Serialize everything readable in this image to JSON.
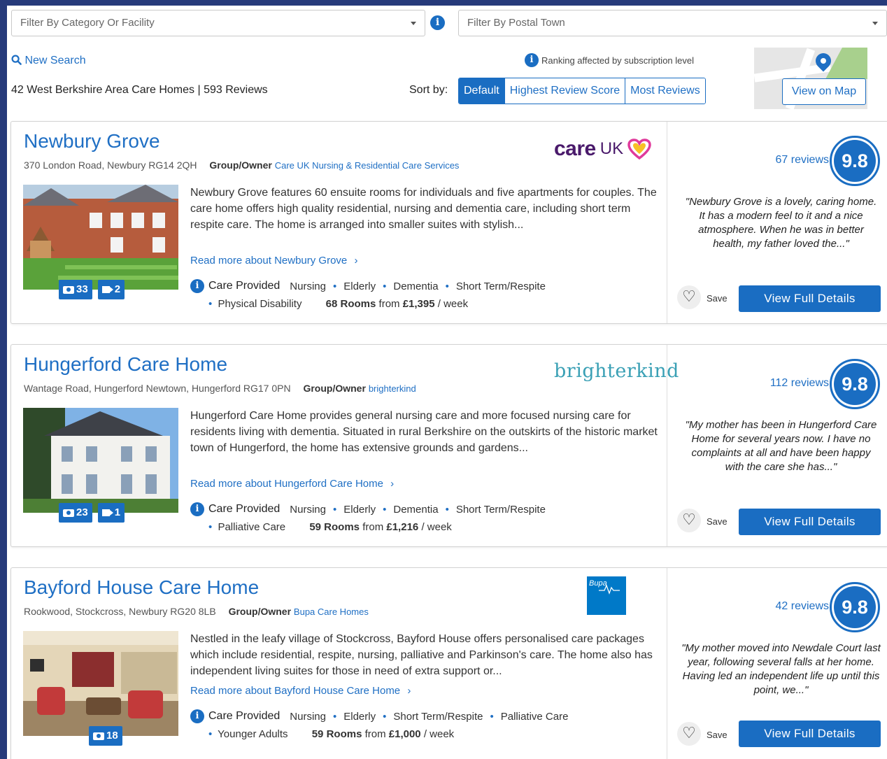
{
  "filters": {
    "category_placeholder": "Filter By Category Or Facility",
    "postal_placeholder": "Filter By Postal Town"
  },
  "toolbar": {
    "new_search": "New Search",
    "ranking_note": "Ranking affected by subscription level",
    "summary": "42 West Berkshire Area Care Homes | 593 Reviews",
    "sort_label": "Sort by:",
    "sort_options": [
      "Default",
      "Highest Review Score",
      "Most Reviews"
    ],
    "sort_selected": "Default",
    "view_on_map": "View on Map"
  },
  "labels": {
    "care_provided": "Care Provided",
    "save": "Save",
    "view_full_details": "View Full Details"
  },
  "colors": {
    "accent": "#1a6dc2",
    "background": "#263a7a",
    "link": "#1f6fc4"
  },
  "homes": [
    {
      "name": "Newbury Grove",
      "address": "370 London Road, Newbury RG14 2QH",
      "owner_label": "Group/Owner",
      "owner": "Care UK Nursing & Residential Care Services",
      "logo": "care UK",
      "description": "Newbury Grove features 60 ensuite rooms for individuals and five apartments for couples. The care home offers high quality residential, nursing and dementia care, including short term respite care. The home is arranged into smaller suites with stylish...",
      "read_more": "Read more about Newbury Grove",
      "photos": "33",
      "videos": "2",
      "care": [
        "Nursing",
        "Elderly",
        "Dementia",
        "Short Term/Respite"
      ],
      "care_extra": "Physical Disability",
      "rooms": "68 Rooms",
      "from_label": "from",
      "price": "£1,395",
      "per": "/ week",
      "reviews": "67 reviews",
      "score": "9.8",
      "quote": "\"Newbury Grove is a lovely, caring home. It has a modern feel to it and a nice atmosphere. When he was in better health, my father loved the...\""
    },
    {
      "name": "Hungerford Care Home",
      "address": "Wantage Road, Hungerford Newtown, Hungerford RG17 0PN",
      "owner_label": "Group/Owner",
      "owner": "brighterkind",
      "logo": "brighterkind",
      "description": "Hungerford Care Home provides general nursing care and more focused nursing care for residents living with dementia. Situated in rural Berkshire on the outskirts of the historic market town of Hungerford, the home has extensive grounds and gardens...",
      "read_more": "Read more about Hungerford Care Home",
      "photos": "23",
      "videos": "1",
      "care": [
        "Nursing",
        "Elderly",
        "Dementia",
        "Short Term/Respite"
      ],
      "care_extra": "Palliative Care",
      "rooms": "59 Rooms",
      "from_label": "from",
      "price": "£1,216",
      "per": "/ week",
      "reviews": "112 reviews",
      "score": "9.8",
      "quote": "\"My mother has been in Hungerford Care Home for several years now. I have no complaints at all and have been happy with the care she has...\""
    },
    {
      "name": "Bayford House Care Home",
      "address": "Rookwood, Stockcross, Newbury RG20 8LB",
      "owner_label": "Group/Owner",
      "owner": "Bupa Care Homes",
      "logo": "Bupa",
      "description": "Nestled in the leafy village of Stockcross, Bayford House offers personalised care packages which include residential, respite, nursing, palliative and Parkinson's care. The home also has independent living suites for those in need of extra support or...",
      "read_more": "Read more about Bayford House Care Home",
      "photos": "18",
      "care": [
        "Nursing",
        "Elderly",
        "Short Term/Respite",
        "Palliative Care"
      ],
      "care_extra": "Younger Adults",
      "rooms": "59 Rooms",
      "from_label": "from",
      "price": "£1,000",
      "per": "/ week",
      "reviews": "42 reviews",
      "score": "9.8",
      "quote": "\"My mother moved into Newdale Court last year, following several falls at her home. Having led an independent life up until this point, we...\""
    }
  ]
}
